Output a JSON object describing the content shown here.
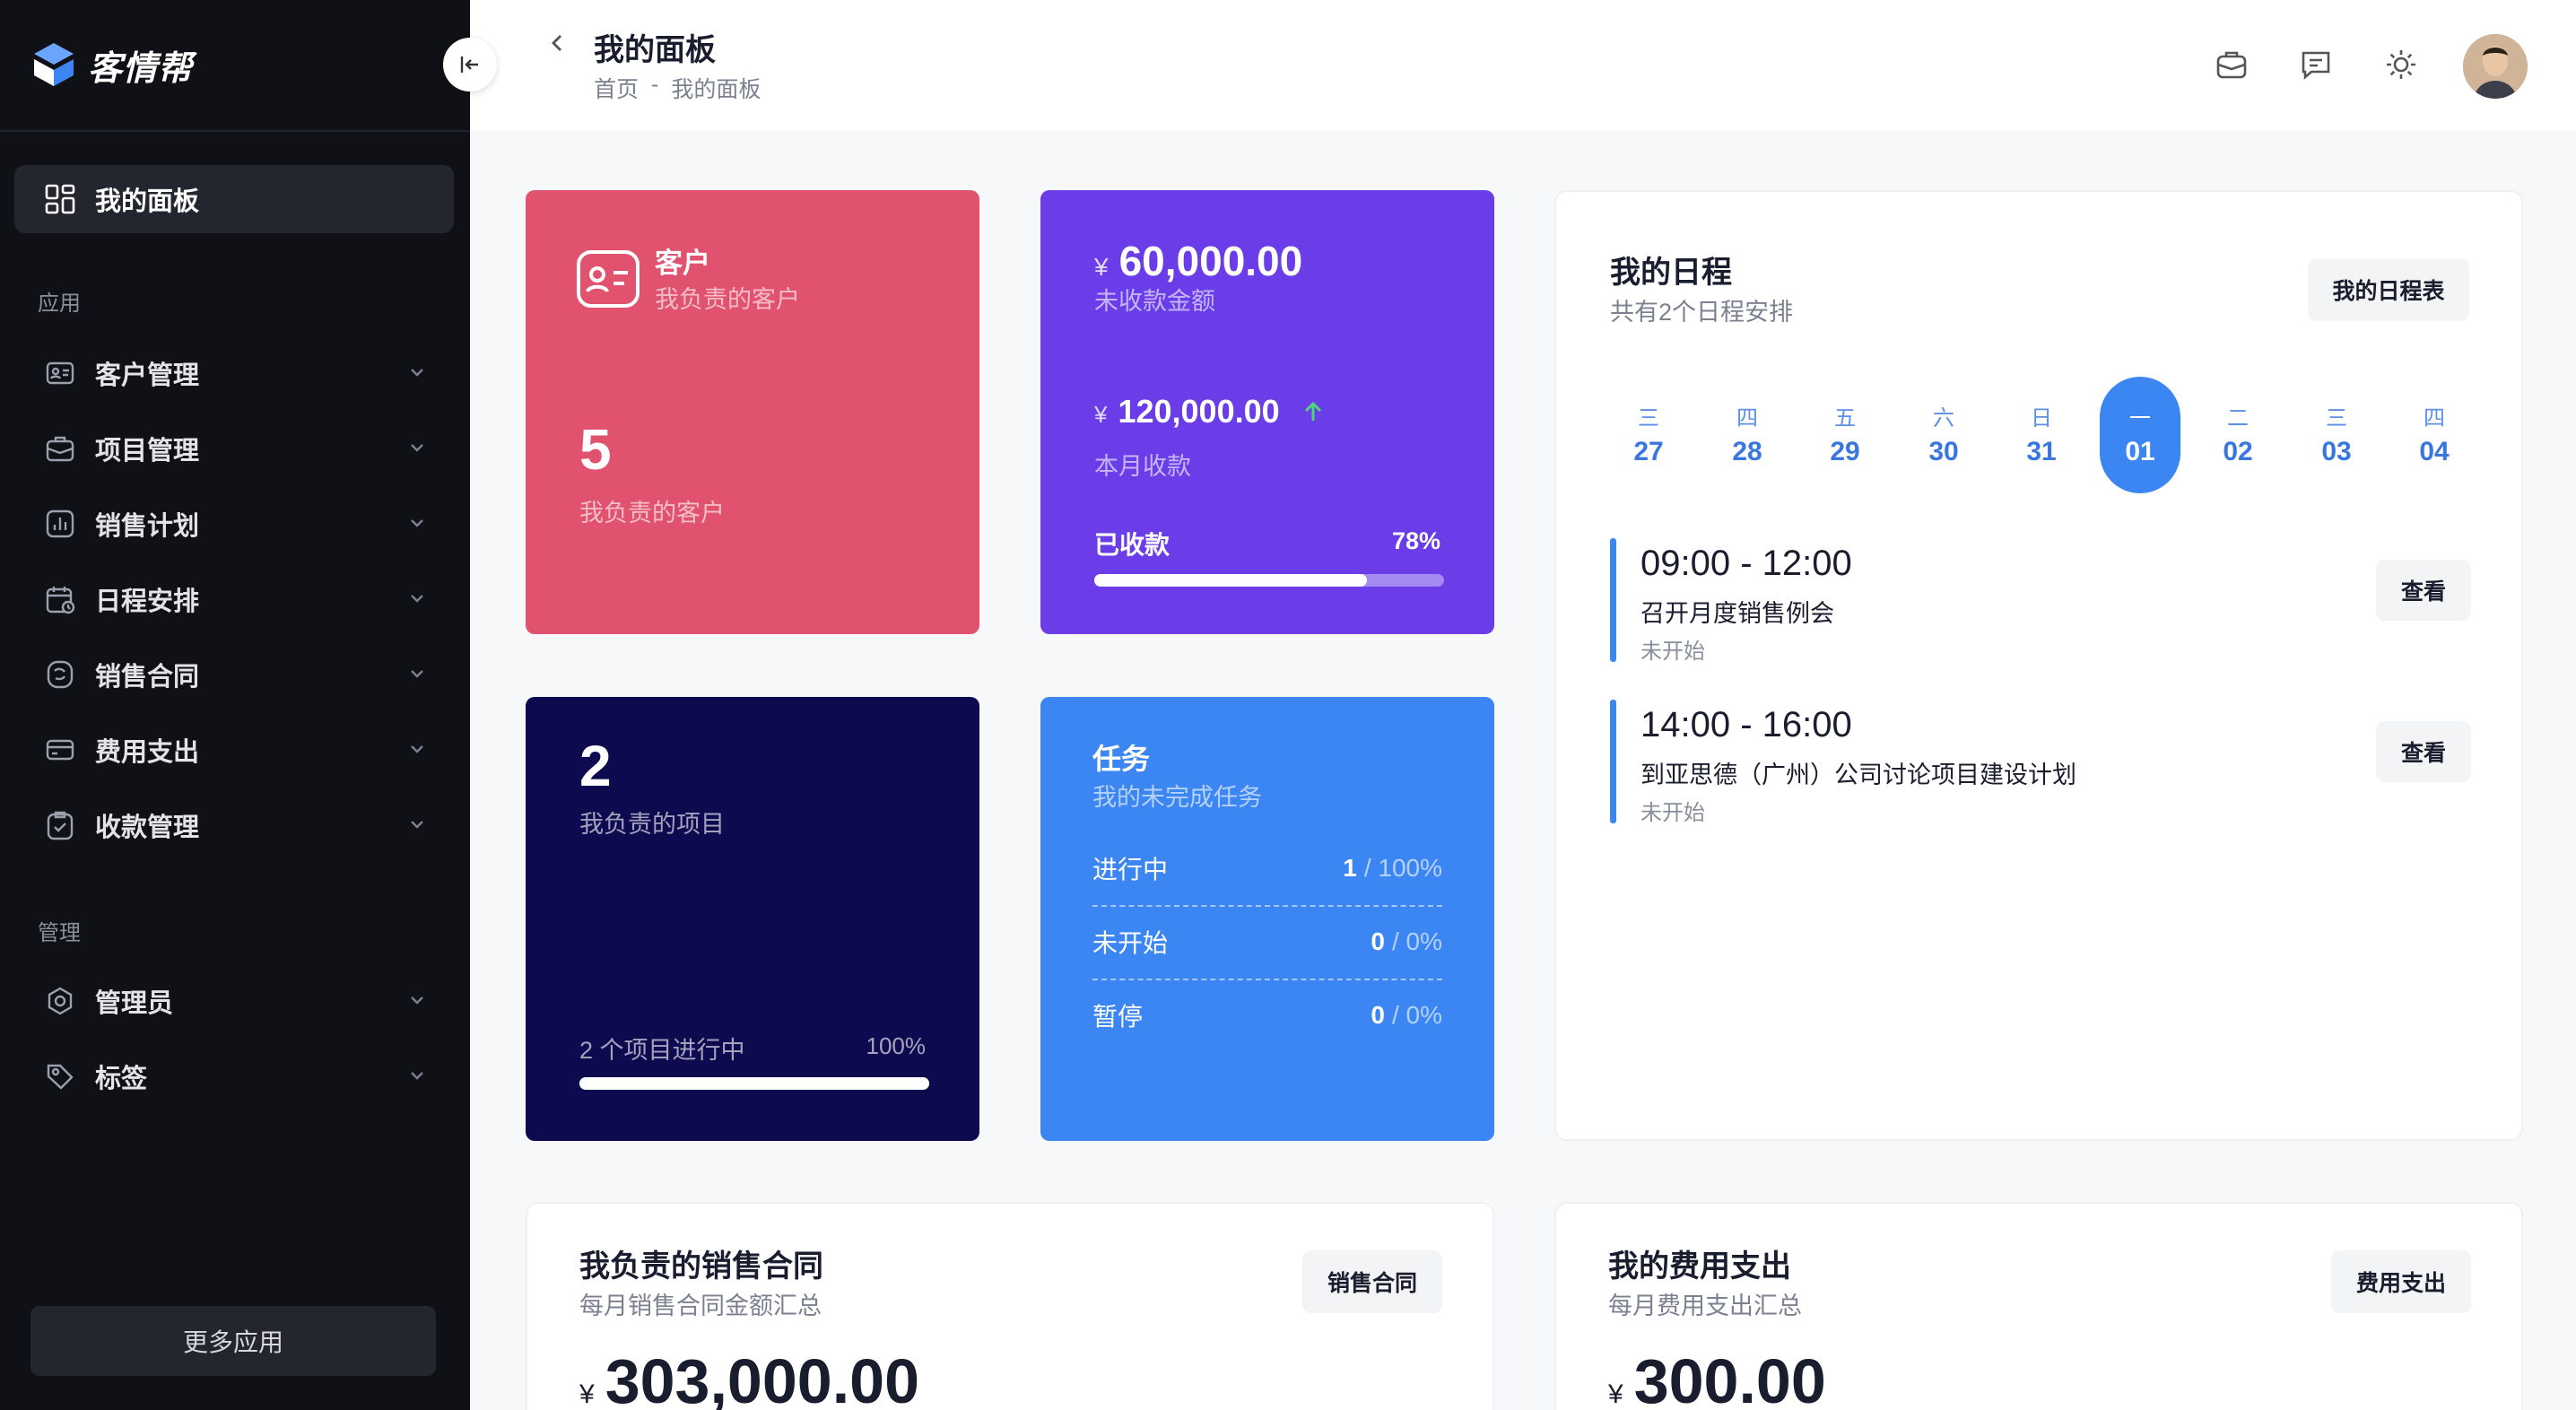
{
  "brand": {
    "name": "客情帮"
  },
  "sidebar": {
    "active_item": "我的面板",
    "section_apps": "应用",
    "apps": [
      "客户管理",
      "项目管理",
      "销售计划",
      "日程安排",
      "销售合同",
      "费用支出",
      "收款管理"
    ],
    "section_admin": "管理",
    "admin": [
      "管理员",
      "标签"
    ],
    "more_button": "更多应用"
  },
  "header": {
    "title": "我的面板",
    "breadcrumb": {
      "home": "首页",
      "separator": "-",
      "current": "我的面板"
    }
  },
  "cards": {
    "customers": {
      "title": "客户",
      "subtitle": "我负责的客户",
      "count": "5",
      "count_label": "我负责的客户"
    },
    "receivable": {
      "currency": "¥",
      "outstanding": "60,000.00",
      "outstanding_label": "未收款金额",
      "month_amount": "120,000.00",
      "month_label": "本月收款",
      "collected_label": "已收款",
      "collected_pct": "78%",
      "progress": 0.78
    },
    "projects": {
      "count": "2",
      "label": "我负责的项目",
      "progress_label": "2 个项目进行中",
      "progress_pct": "100%",
      "progress": 1.0
    },
    "tasks": {
      "title": "任务",
      "subtitle": "我的未完成任务",
      "rows": [
        {
          "label": "进行中",
          "count": "1",
          "pct": "/ 100%"
        },
        {
          "label": "未开始",
          "count": "0",
          "pct": "/ 0%"
        },
        {
          "label": "暂停",
          "count": "0",
          "pct": "/ 0%"
        }
      ]
    }
  },
  "schedule": {
    "title": "我的日程",
    "subtitle": "共有2个日程安排",
    "button": "我的日程表",
    "days": [
      {
        "wk": "三",
        "d": "27"
      },
      {
        "wk": "四",
        "d": "28"
      },
      {
        "wk": "五",
        "d": "29"
      },
      {
        "wk": "六",
        "d": "30"
      },
      {
        "wk": "日",
        "d": "31"
      },
      {
        "wk": "一",
        "d": "01"
      },
      {
        "wk": "二",
        "d": "02"
      },
      {
        "wk": "三",
        "d": "03"
      },
      {
        "wk": "四",
        "d": "04"
      }
    ],
    "selected_index": 5,
    "events": [
      {
        "time": "09:00 - 12:00",
        "title": "召开月度销售例会",
        "status": "未开始",
        "action": "查看"
      },
      {
        "time": "14:00 - 16:00",
        "title": "到亚思德（广州）公司讨论项目建设计划",
        "status": "未开始",
        "action": "查看"
      }
    ]
  },
  "contracts": {
    "title": "我负责的销售合同",
    "subtitle": "每月销售合同金额汇总",
    "button": "销售合同",
    "currency": "¥",
    "amount": "303,000.00"
  },
  "expenses": {
    "title": "我的费用支出",
    "subtitle": "每月费用支出汇总",
    "button": "费用支出",
    "currency": "¥",
    "amount": "300.00"
  },
  "colors": {
    "customer_card": "#e0526e",
    "receivable_card": "#6a3de8",
    "project_card": "#0e0a4f",
    "task_card": "#3b86f2",
    "accent": "#3b86f2",
    "up_arrow": "#4fd67a"
  }
}
